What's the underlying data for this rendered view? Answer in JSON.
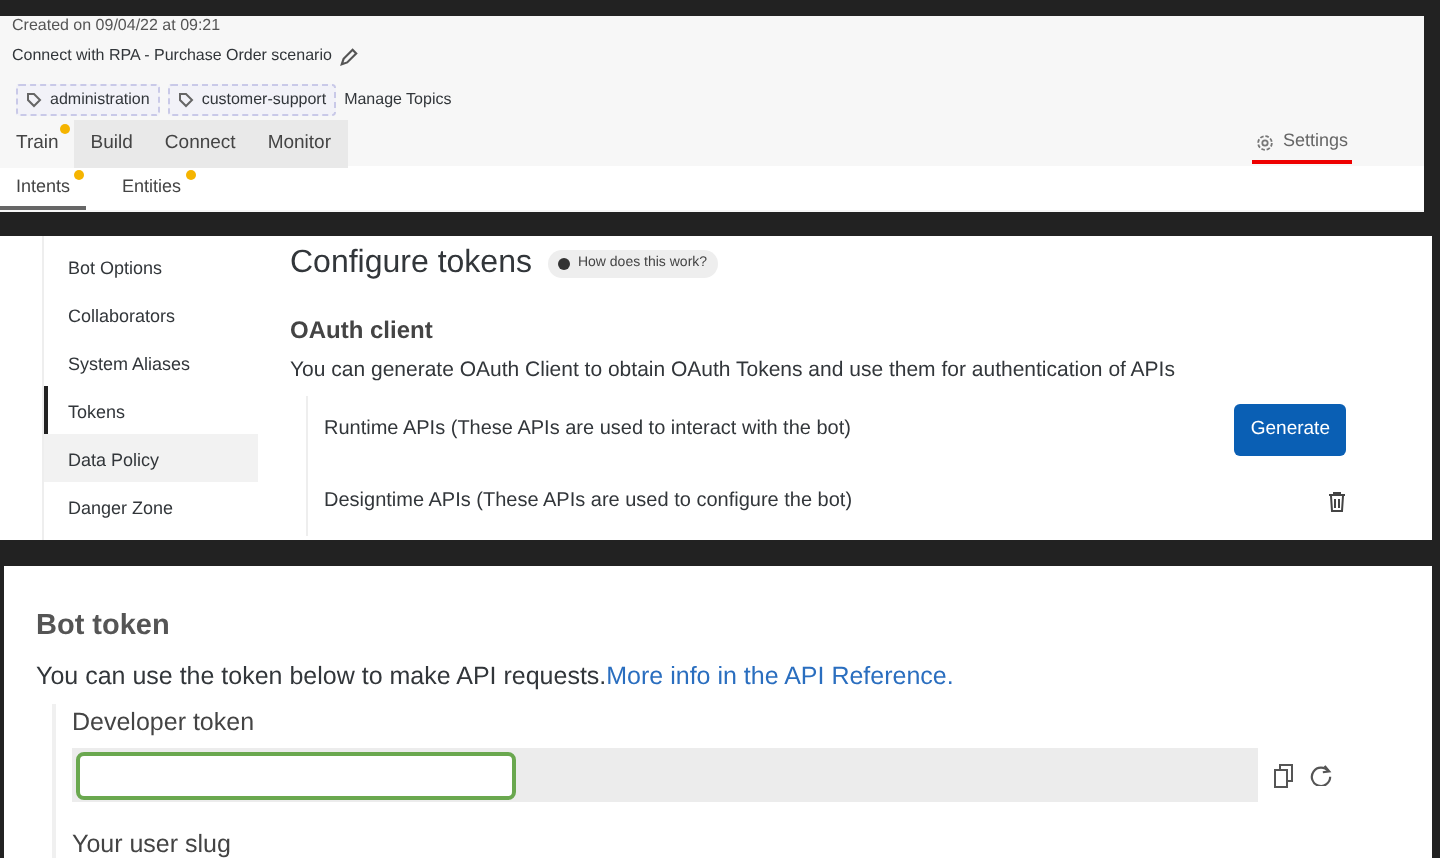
{
  "header": {
    "created": "Created on 09/04/22 at 09:21",
    "bot_description": "Connect with RPA - Purchase Order scenario",
    "topics": [
      "administration",
      "customer-support"
    ],
    "manage_topics": "Manage Topics"
  },
  "tabs": [
    {
      "label": "Train",
      "selected": true,
      "dot": true
    },
    {
      "label": "Build",
      "selected": false,
      "dot": false
    },
    {
      "label": "Connect",
      "selected": false,
      "dot": false
    },
    {
      "label": "Monitor",
      "selected": false,
      "dot": false
    }
  ],
  "settings_tab": {
    "label": "Settings",
    "selected": true
  },
  "subtabs": [
    {
      "label": "Intents",
      "selected": true,
      "dot": true
    },
    {
      "label": "Entities",
      "selected": false,
      "dot": true
    }
  ],
  "sidebar": {
    "items": [
      {
        "label": "Bot Options",
        "selected": false,
        "hovered": false
      },
      {
        "label": "Collaborators",
        "selected": false,
        "hovered": false
      },
      {
        "label": "System Aliases",
        "selected": false,
        "hovered": false
      },
      {
        "label": "Tokens",
        "selected": true,
        "hovered": false
      },
      {
        "label": "Data Policy",
        "selected": false,
        "hovered": true
      },
      {
        "label": "Danger Zone",
        "selected": false,
        "hovered": false
      }
    ]
  },
  "configure": {
    "title": "Configure tokens",
    "help": "How does this work?",
    "oauth_title": "OAuth client",
    "oauth_description": "You can generate OAuth Client to obtain OAuth Tokens and use them for authentication of APIs",
    "rows": [
      {
        "label": "Runtime APIs (These APIs are used to interact with the bot)",
        "kind": "generate",
        "button": "Generate"
      },
      {
        "label": "Designtime APIs (These APIs are used to configure the bot)",
        "kind": "delete"
      }
    ]
  },
  "bot_token": {
    "title": "Bot token",
    "description": "You can use the token below to make API requests.",
    "link": "More info in the API Reference.",
    "developer_token_label": "Developer token",
    "next_label": "Your user slug"
  }
}
